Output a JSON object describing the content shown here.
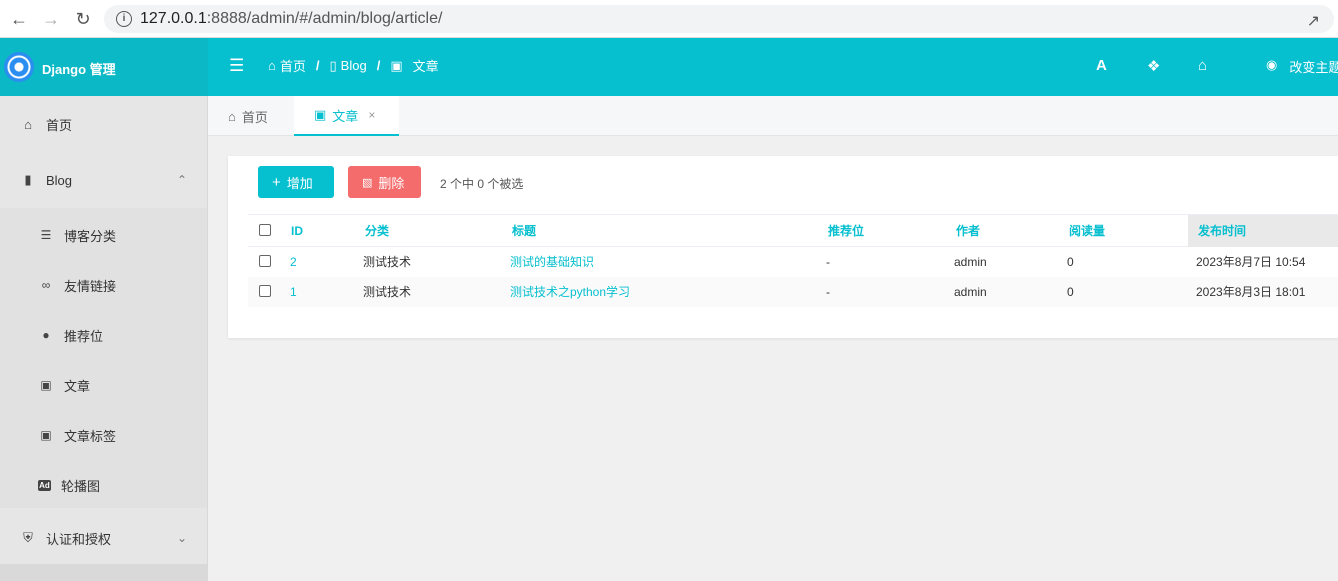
{
  "browser": {
    "url_host": "127.0.0.1",
    "url_rest": ":8888/admin/#/admin/blog/article/"
  },
  "header": {
    "logo_text": "Django 管理",
    "breadcrumb": [
      {
        "label": "首页",
        "icon": "home-icon"
      },
      {
        "label": "Blog",
        "icon": "bookmark-icon"
      },
      {
        "label": "文章",
        "icon": "book-icon"
      }
    ],
    "theme_label": "改变主题"
  },
  "sidebar": {
    "home": "首页",
    "blog": "Blog",
    "blog_items": [
      {
        "label": "博客分类",
        "icon": "list-icon"
      },
      {
        "label": "友情链接",
        "icon": "link-icon"
      },
      {
        "label": "推荐位",
        "icon": "circle-icon"
      },
      {
        "label": "文章",
        "icon": "book-icon"
      },
      {
        "label": "文章标签",
        "icon": "book-icon"
      },
      {
        "label": "轮播图",
        "icon": "ad-icon"
      }
    ],
    "auth": "认证和授权"
  },
  "tabs": [
    {
      "label": "首页",
      "icon": "home-icon"
    },
    {
      "label": "文章",
      "icon": "book-icon"
    }
  ],
  "toolbar": {
    "add_label": "增加",
    "delete_label": "删除",
    "selection_text": "2 个中 0 个被选"
  },
  "table": {
    "headers": [
      "ID",
      "分类",
      "标题",
      "推荐位",
      "作者",
      "阅读量",
      "发布时间"
    ],
    "rows": [
      [
        "2",
        "测试技术",
        "测试的基础知识",
        "-",
        "admin",
        "0",
        "2023年8月7日 10:54"
      ],
      [
        "1",
        "测试技术",
        "测试技术之python学习",
        "-",
        "admin",
        "0",
        "2023年8月3日 18:01"
      ]
    ]
  },
  "colors": {
    "accent": "#06bfcf",
    "danger": "#f56c6c"
  }
}
